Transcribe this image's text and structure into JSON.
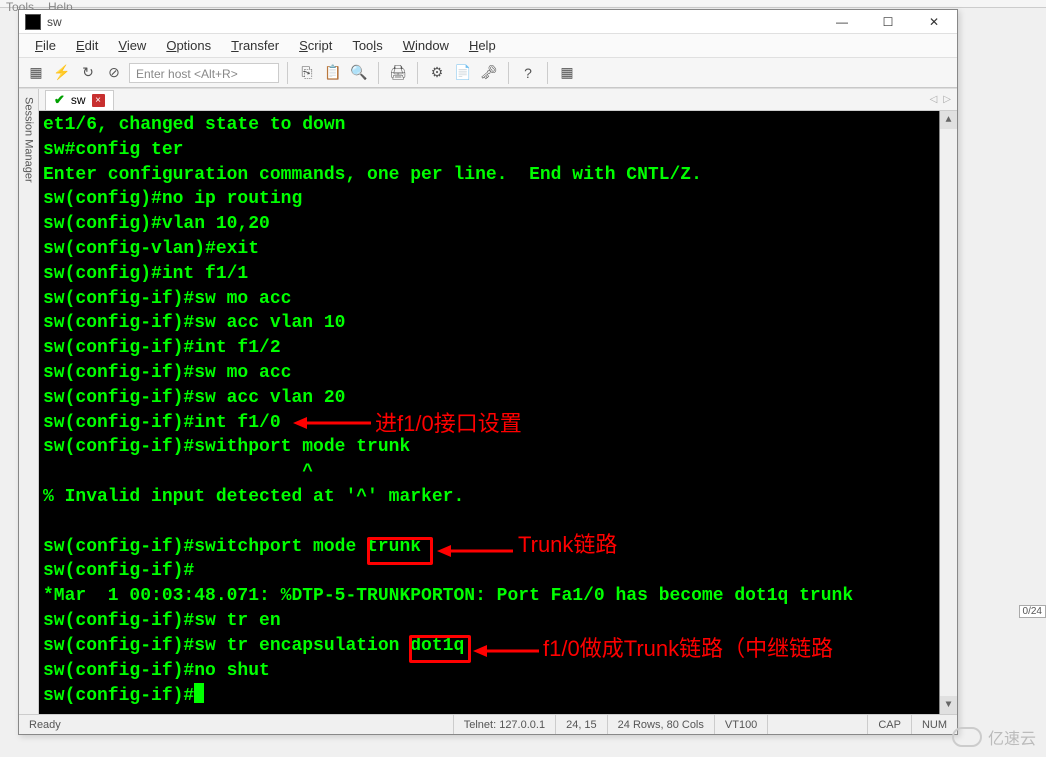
{
  "outer_menu": {
    "tools": "Tools",
    "help": "Help"
  },
  "window": {
    "title": "sw",
    "minimize": "—",
    "maximize": "☐",
    "close": "✕"
  },
  "menubar": {
    "file": "File",
    "edit": "Edit",
    "view": "View",
    "options": "Options",
    "transfer": "Transfer",
    "script": "Script",
    "tools": "Tools",
    "window": "Window",
    "help": "Help"
  },
  "toolbar": {
    "host_placeholder": "Enter host <Alt+R>"
  },
  "side_tab": "Session Manager",
  "tab": {
    "name": "sw"
  },
  "tab_nav": {
    "left": "◁",
    "right": "▷"
  },
  "terminal_lines": [
    "et1/6, changed state to down",
    "sw#config ter",
    "Enter configuration commands, one per line.  End with CNTL/Z.",
    "sw(config)#no ip routing",
    "sw(config)#vlan 10,20",
    "sw(config-vlan)#exit",
    "sw(config)#int f1/1",
    "sw(config-if)#sw mo acc",
    "sw(config-if)#sw acc vlan 10",
    "sw(config-if)#int f1/2",
    "sw(config-if)#sw mo acc",
    "sw(config-if)#sw acc vlan 20",
    "sw(config-if)#int f1/0",
    "sw(config-if)#swithport mode trunk",
    "                        ^",
    "% Invalid input detected at '^' marker.",
    "",
    "sw(config-if)#switchport mode trunk",
    "sw(config-if)#",
    "*Mar  1 00:03:48.071: %DTP-5-TRUNKPORTON: Port Fa1/0 has become dot1q trunk",
    "sw(config-if)#sw tr en",
    "sw(config-if)#sw tr encapsulation dot1q",
    "sw(config-if)#no shut",
    "sw(config-if)#"
  ],
  "annotations": {
    "a1": "进f1/0接口设置",
    "a2": "Trunk链路",
    "a3": "f1/0做成Trunk链路（中继链路"
  },
  "statusbar": {
    "ready": "Ready",
    "telnet": "Telnet: 127.0.0.1",
    "cursor": "24, 15",
    "dims": "24 Rows, 80 Cols",
    "emul": "VT100",
    "cap": "CAP",
    "num": "NUM"
  },
  "right_tag": "0/24",
  "watermark": "亿速云"
}
